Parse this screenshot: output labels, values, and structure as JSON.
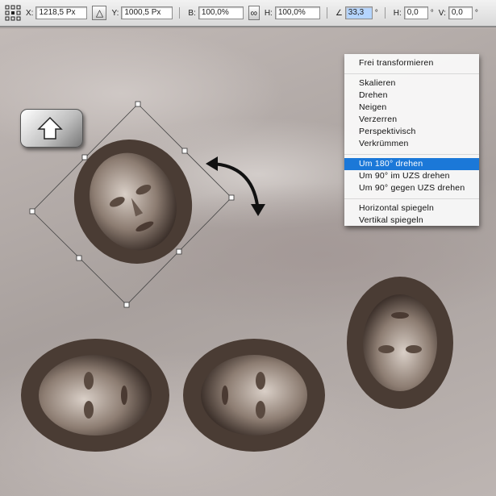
{
  "toolbar": {
    "x_label": "X:",
    "x_value": "1218,5 Px",
    "y_label": "Y:",
    "y_value": "1000,5 Px",
    "b_label": "B:",
    "b_value": "100,0%",
    "h_label": "H:",
    "h_value": "100,0%",
    "angle_value": "33,3",
    "deg": "°",
    "hskew_label": "H:",
    "hskew_value": "0,0",
    "vskew_label": "V:",
    "vskew_value": "0,0",
    "reference_icon": "reference-point-grid-icon",
    "delta_icon": "triangle-relative-icon",
    "link_icon": "chain-link-icon",
    "angle_icon": "angle-icon"
  },
  "menu": {
    "groups": [
      [
        "Frei transformieren"
      ],
      [
        "Skalieren",
        "Drehen",
        "Neigen",
        "Verzerren",
        "Perspektivisch",
        "Verkrümmen"
      ],
      [
        "Um 180° drehen",
        "Um 90° im UZS drehen",
        "Um 90° gegen UZS drehen"
      ],
      [
        "Horizontal spiegeln",
        "Vertikal spiegeln"
      ]
    ],
    "selected": "Um 180° drehen"
  },
  "accent": "#1b78d8"
}
